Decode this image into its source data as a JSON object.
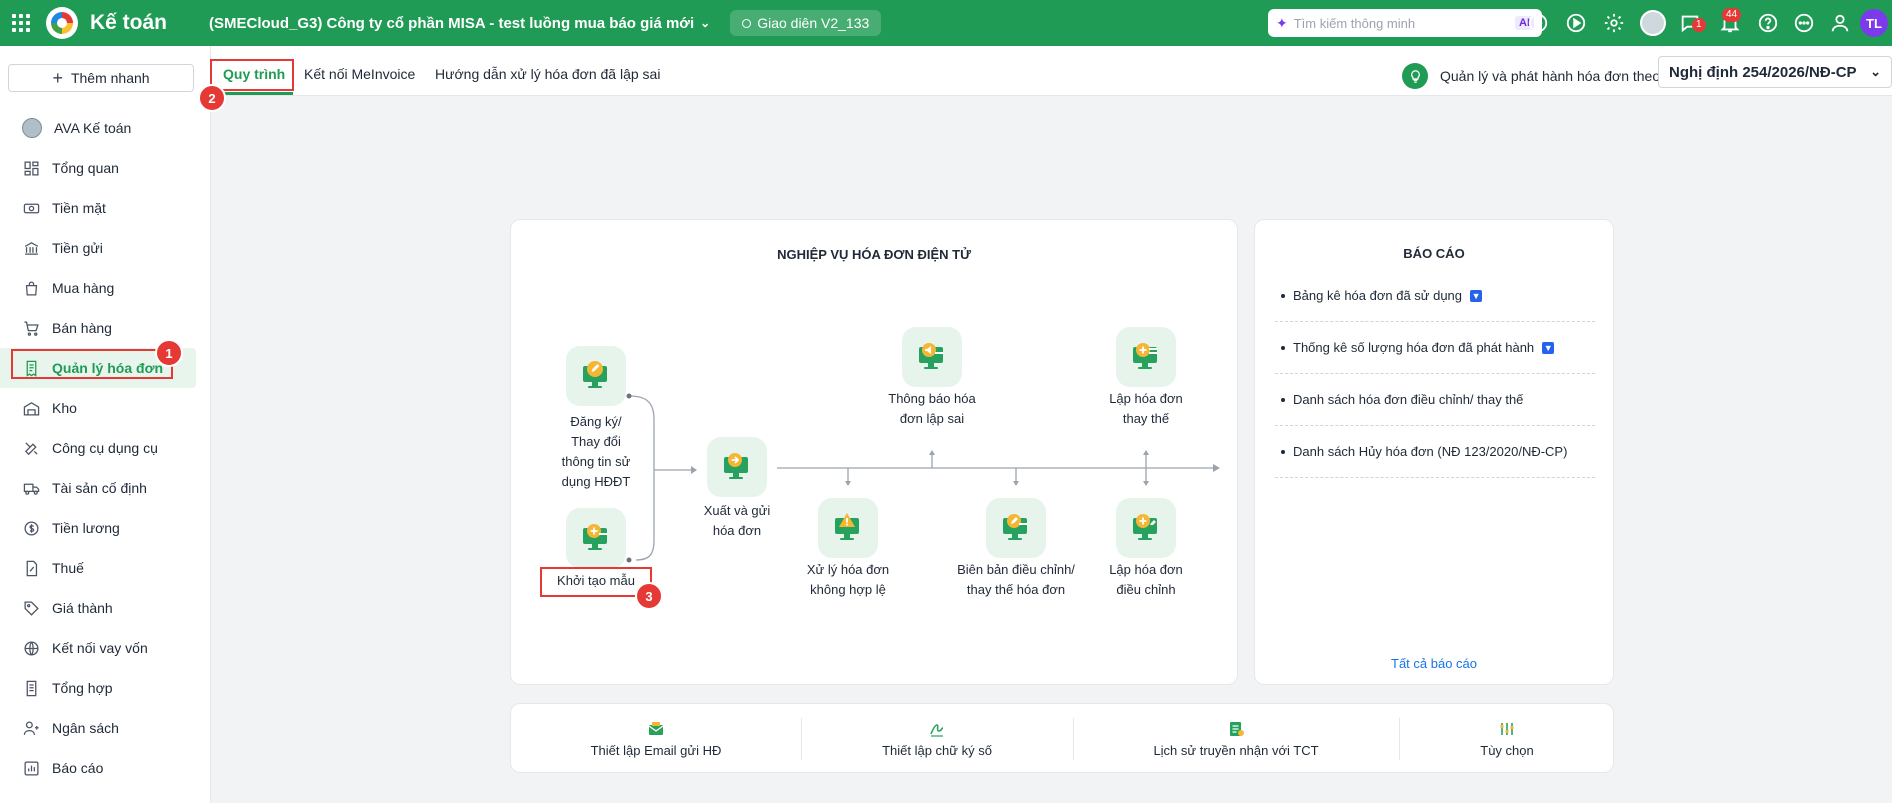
{
  "topbar": {
    "app_title": "Kế toán",
    "company": "(SMECloud_G3) Công ty cổ phần MISA - test luồng mua báo giá mới",
    "ui_version": "Giao diên V2_133",
    "search_placeholder": "Tìm kiếm thông minh",
    "ai_label": "AI",
    "chat_badge": "1",
    "notif_badge": "44",
    "user_initials": "TL"
  },
  "sidebar": {
    "quick_add": "Thêm nhanh",
    "items": [
      {
        "label": "AVA Kế toán",
        "icon": "ava-avatar"
      },
      {
        "label": "Tổng quan",
        "icon": "dashboard-icon"
      },
      {
        "label": "Tiền mặt",
        "icon": "cash-icon"
      },
      {
        "label": "Tiền gửi",
        "icon": "bank-icon"
      },
      {
        "label": "Mua hàng",
        "icon": "shopping-bag-icon"
      },
      {
        "label": "Bán hàng",
        "icon": "cart-icon"
      },
      {
        "label": "Quản lý hóa đơn",
        "icon": "invoice-icon"
      },
      {
        "label": "Kho",
        "icon": "warehouse-icon"
      },
      {
        "label": "Công cụ dụng cụ",
        "icon": "tools-icon"
      },
      {
        "label": "Tài sản cố định",
        "icon": "truck-icon"
      },
      {
        "label": "Tiền lương",
        "icon": "salary-icon"
      },
      {
        "label": "Thuế",
        "icon": "tax-icon"
      },
      {
        "label": "Giá thành",
        "icon": "price-tag-icon"
      },
      {
        "label": "Kết nối vay vốn",
        "icon": "loan-icon"
      },
      {
        "label": "Tổng hợp",
        "icon": "summary-icon"
      },
      {
        "label": "Ngân sách",
        "icon": "budget-icon"
      },
      {
        "label": "Báo cáo",
        "icon": "report-icon"
      }
    ]
  },
  "tabs": [
    {
      "label": "Quy trình",
      "active": true
    },
    {
      "label": "Kết nối MeInvoice",
      "active": false
    },
    {
      "label": "Hướng dẫn xử lý hóa đơn đã lập sai",
      "active": false
    }
  ],
  "decree": {
    "label": "Quản lý và phát hành hóa đơn theo:",
    "value": "Nghị định 254/2026/NĐ-CP"
  },
  "annotations": [
    "1",
    "2",
    "3"
  ],
  "flow": {
    "title": "NGHIỆP VỤ HÓA ĐƠN ĐIỆN TỬ",
    "nodes": {
      "register": "Đăng ký/\nThay đổi\nthông tin sử\ndụng HĐĐT",
      "init_template": "Khởi tạo mẫu",
      "issue_send": "Xuất và gửi\nhóa đơn",
      "handle_invalid": "Xử lý hóa đơn\nkhông hợp lệ",
      "notify_wrong": "Thông báo hóa\nđơn lập sai",
      "minutes": "Biên bản điều chỉnh/\nthay thế hóa đơn",
      "replace": "Lập hóa đơn\nthay thế",
      "adjust": "Lập hóa đơn\nđiều chỉnh"
    }
  },
  "reports": {
    "title": "BÁO CÁO",
    "items": [
      {
        "label": "Bảng kê hóa đơn đã sử dụng",
        "pro": true
      },
      {
        "label": "Thống kê số lượng hóa đơn đã phát hành",
        "pro": true
      },
      {
        "label": "Danh sách hóa đơn điều chỉnh/ thay thế",
        "pro": false
      },
      {
        "label": "Danh sách Hủy hóa đơn (NĐ 123/2020/NĐ-CP)",
        "pro": false
      }
    ],
    "all_link": "Tất cả báo cáo"
  },
  "bottom_bar": [
    {
      "label": "Thiết lập Email gửi HĐ",
      "icon": "email-icon"
    },
    {
      "label": "Thiết lập chữ ký số",
      "icon": "signature-icon"
    },
    {
      "label": "Lịch sử truyền nhận với TCT",
      "icon": "history-icon"
    },
    {
      "label": "Tùy chọn",
      "icon": "options-icon"
    }
  ]
}
